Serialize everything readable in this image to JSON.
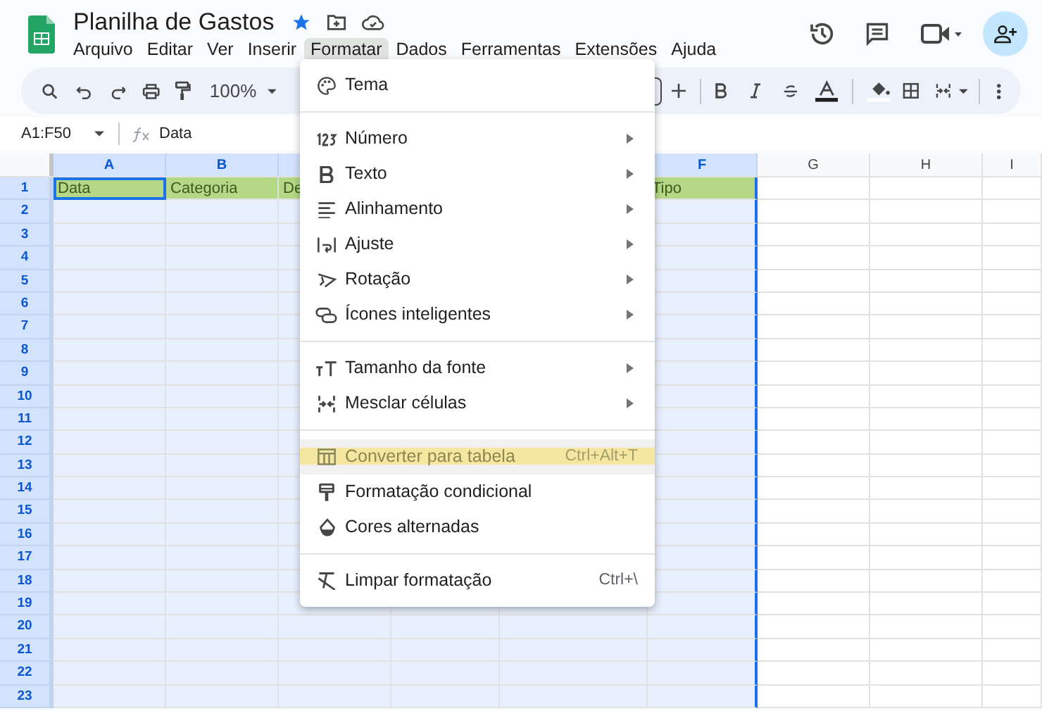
{
  "document": {
    "title": "Planilha de Gastos"
  },
  "menu_bar": [
    {
      "label": "Arquivo",
      "selected": false
    },
    {
      "label": "Editar",
      "selected": false
    },
    {
      "label": "Ver",
      "selected": false
    },
    {
      "label": "Inserir",
      "selected": false
    },
    {
      "label": "Formatar",
      "selected": true
    },
    {
      "label": "Dados",
      "selected": false
    },
    {
      "label": "Ferramentas",
      "selected": false
    },
    {
      "label": "Extensões",
      "selected": false
    },
    {
      "label": "Ajuda",
      "selected": false
    }
  ],
  "toolbar": {
    "zoom": "100%"
  },
  "formula_bar": {
    "range": "A1:F50",
    "value": "Data"
  },
  "sheet": {
    "columns": [
      {
        "label": "A",
        "selected": true
      },
      {
        "label": "B",
        "selected": true
      },
      {
        "selected": true
      },
      {
        "selected": true
      },
      {
        "selected": true
      },
      {
        "label": "F",
        "selected": true
      },
      {
        "label": "G",
        "selected": false
      },
      {
        "label": "H",
        "selected": false
      },
      {
        "label": "I",
        "selected": false
      }
    ],
    "rows": [
      {
        "label": "1",
        "selected": true,
        "highlighted": true,
        "cells": [
          "Data",
          "Categoria",
          "De",
          null,
          null,
          "Tipo"
        ]
      },
      {
        "label": "2",
        "selected": true
      },
      {
        "label": "3",
        "selected": true
      },
      {
        "label": "4",
        "selected": true
      },
      {
        "label": "5",
        "selected": true
      },
      {
        "label": "6",
        "selected": true
      },
      {
        "label": "7",
        "selected": true
      },
      {
        "label": "8",
        "selected": true
      },
      {
        "label": "9",
        "selected": true
      },
      {
        "label": "10",
        "selected": true
      },
      {
        "label": "11",
        "selected": true
      },
      {
        "label": "12",
        "selected": true
      },
      {
        "label": "13",
        "selected": true
      },
      {
        "label": "14",
        "selected": true
      },
      {
        "label": "15",
        "selected": true
      },
      {
        "label": "16",
        "selected": true
      },
      {
        "label": "17",
        "selected": true
      },
      {
        "label": "18",
        "selected": true
      },
      {
        "label": "19",
        "selected": true
      },
      {
        "label": "20",
        "selected": true
      },
      {
        "label": "21",
        "selected": true
      },
      {
        "label": "22",
        "selected": true
      },
      {
        "label": "23",
        "selected": true
      }
    ]
  },
  "format_menu": {
    "groups": [
      [
        {
          "label": "Tema",
          "submenu": false,
          "highlighted": false
        }
      ],
      [
        {
          "label": "Número",
          "submenu": true,
          "highlighted": false
        },
        {
          "label": "Texto",
          "submenu": true,
          "highlighted": false
        },
        {
          "label": "Alinhamento",
          "submenu": true,
          "highlighted": false
        },
        {
          "label": "Ajuste",
          "submenu": true,
          "highlighted": false
        },
        {
          "label": "Rotação",
          "submenu": true,
          "highlighted": false
        },
        {
          "label": "Ícones inteligentes",
          "submenu": true,
          "highlighted": false
        }
      ],
      [
        {
          "label": "Tamanho da fonte",
          "submenu": true,
          "highlighted": false
        },
        {
          "label": "Mesclar células",
          "submenu": true,
          "highlighted": false
        }
      ],
      [
        {
          "label": "Converter para tabela",
          "shortcut": "Ctrl+Alt+T",
          "submenu": false,
          "highlighted": true
        },
        {
          "label": "Formatação condicional",
          "submenu": false,
          "highlighted": false
        },
        {
          "label": "Cores alternadas",
          "submenu": false,
          "highlighted": false
        }
      ],
      [
        {
          "label": "Limpar formatação",
          "shortcut": "Ctrl+\\",
          "submenu": false,
          "highlighted": false
        }
      ]
    ]
  }
}
